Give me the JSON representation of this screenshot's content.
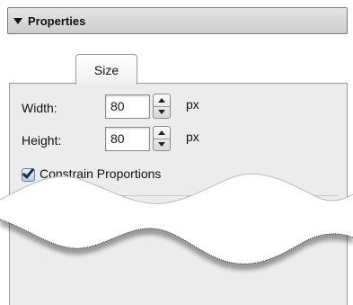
{
  "section": {
    "title": "Properties",
    "expanded": true
  },
  "tabs": [
    {
      "label": "Size",
      "selected": true
    }
  ],
  "width_field": {
    "label": "Width:",
    "value": "80",
    "unit": "px"
  },
  "height_field": {
    "label": "Height:",
    "value": "80",
    "unit": "px"
  },
  "constrain": {
    "label": "Constrain Proportions",
    "checked": true
  }
}
